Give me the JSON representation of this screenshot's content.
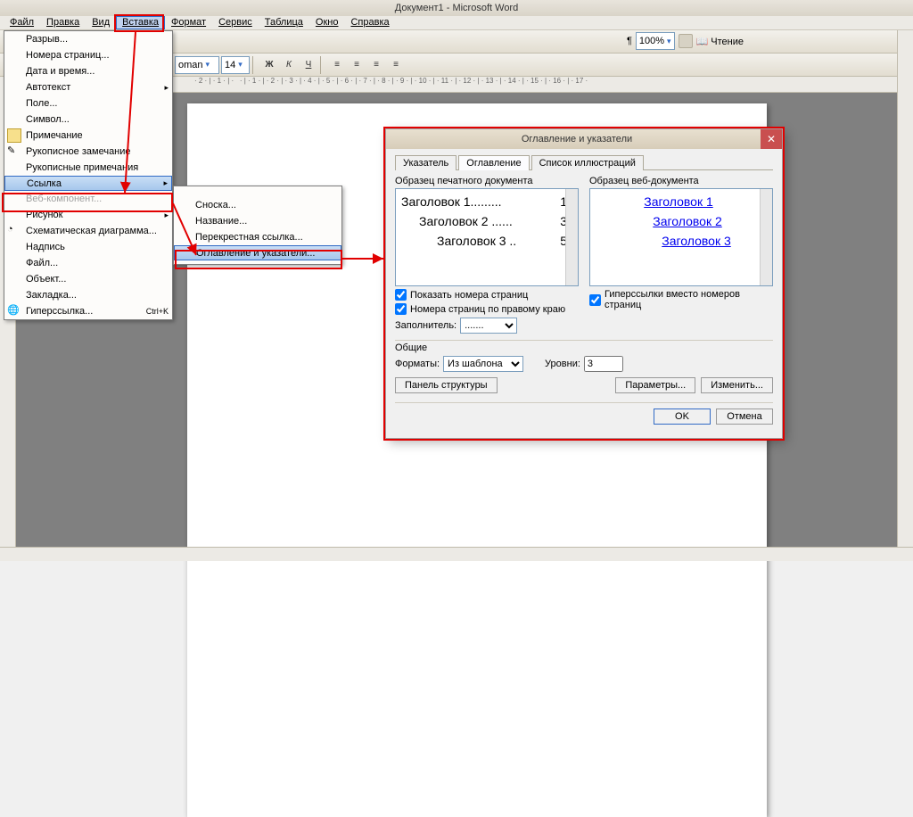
{
  "title": "Документ1 - Microsoft Word",
  "menubar": {
    "file": "Файл",
    "edit": "Правка",
    "view": "Вид",
    "insert": "Вставка",
    "format": "Формат",
    "service": "Сервис",
    "table": "Таблица",
    "window": "Окно",
    "help": "Справка"
  },
  "toolbar": {
    "font": "oman",
    "fontsize": "14",
    "zoom": "100%",
    "reading": "Чтение"
  },
  "insert_menu": {
    "break": "Разрыв...",
    "pagenum": "Номера страниц...",
    "datetime": "Дата и время...",
    "autotext": "Автотекст",
    "field": "Поле...",
    "symbol": "Символ...",
    "comment": "Примечание",
    "ink": "Рукописное замечание",
    "inknotes": "Рукописные примечания",
    "reference": "Ссылка",
    "webcomp": "Веб-компонент...",
    "picture": "Рисунок",
    "diagram": "Схематическая диаграмма...",
    "caption": "Надпись",
    "file": "Файл...",
    "object": "Объект...",
    "bookmark": "Закладка...",
    "hyperlink": "Гиперссылка...",
    "hyperlink_sc": "Ctrl+K"
  },
  "ref_submenu": {
    "footnote": "Сноска...",
    "caption": "Название...",
    "crossref": "Перекрестная ссылка...",
    "toc": "Оглавление и указатели..."
  },
  "dialog": {
    "title": "Оглавление и указатели",
    "tabs": {
      "index": "Указатель",
      "toc": "Оглавление",
      "illus": "Список иллюстраций"
    },
    "print_sample": "Образец печатного документа",
    "web_sample": "Образец веб-документа",
    "print_lines": [
      [
        "Заголовок 1.........",
        "1"
      ],
      [
        "Заголовок 2 ......",
        "3"
      ],
      [
        "Заголовок 3 ..",
        "5"
      ]
    ],
    "web_lines": [
      "Заголовок 1",
      "Заголовок 2",
      "Заголовок 3"
    ],
    "show_pages": "Показать номера страниц",
    "right_align": "Номера страниц по правому краю",
    "hyperlinks": "Гиперссылки вместо номеров страниц",
    "filler": "Заполнитель:",
    "filler_val": ".......",
    "general": "Общие",
    "formats": "Форматы:",
    "formats_val": "Из шаблона",
    "levels": "Уровни:",
    "levels_val": "3",
    "outline": "Панель структуры",
    "params": "Параметры...",
    "modify": "Изменить...",
    "ok": "OK",
    "cancel": "Отмена"
  }
}
